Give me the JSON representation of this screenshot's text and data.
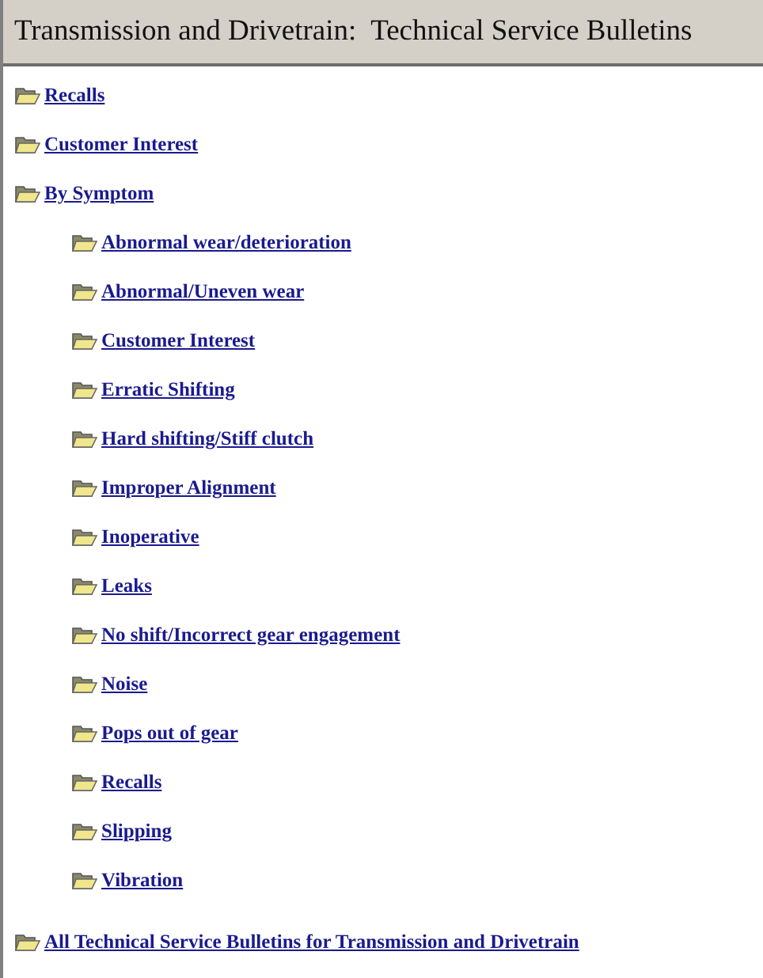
{
  "header": {
    "title": "Transmission and Drivetrain:  Technical Service Bulletins"
  },
  "tree": [
    {
      "label": "Recalls"
    },
    {
      "label": "Customer Interest"
    },
    {
      "label": "By Symptom",
      "children": [
        {
          "label": "Abnormal wear/deterioration"
        },
        {
          "label": "Abnormal/Uneven wear"
        },
        {
          "label": "Customer Interest"
        },
        {
          "label": "Erratic Shifting"
        },
        {
          "label": "Hard shifting/Stiff clutch"
        },
        {
          "label": "Improper Alignment"
        },
        {
          "label": "Inoperative"
        },
        {
          "label": "Leaks"
        },
        {
          "label": "No shift/Incorrect gear engagement"
        },
        {
          "label": "Noise"
        },
        {
          "label": "Pops out of gear"
        },
        {
          "label": "Recalls"
        },
        {
          "label": "Slipping"
        },
        {
          "label": "Vibration"
        }
      ]
    }
  ],
  "footer_link": {
    "label": "All Technical Service Bulletins for Transmission and Drivetrain"
  }
}
